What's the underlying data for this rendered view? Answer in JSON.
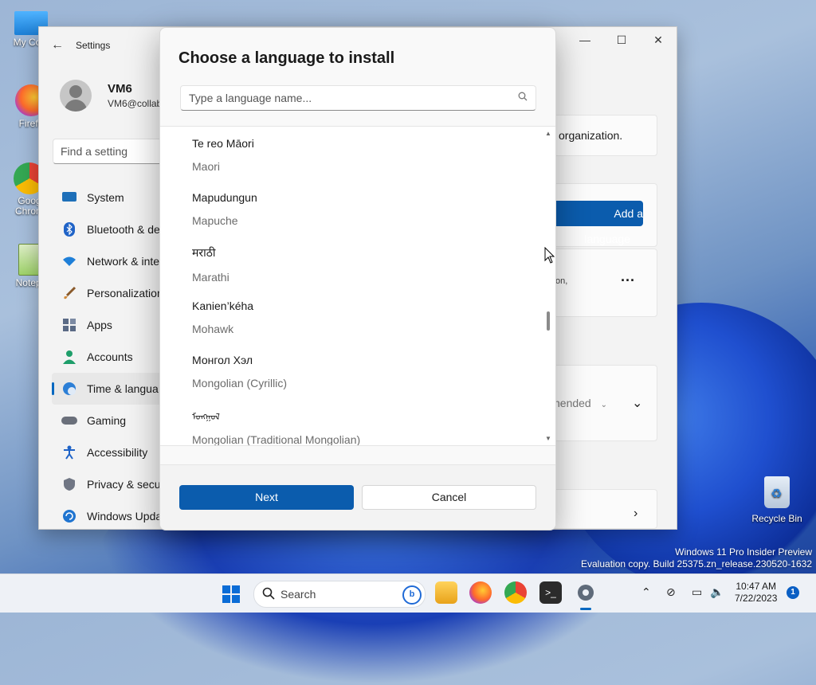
{
  "desktop": {
    "icons": [
      {
        "label": "My Com"
      },
      {
        "label": "Firefo"
      },
      {
        "label": "Goog Chrom"
      },
      {
        "label": "Notepa"
      }
    ],
    "recycle_bin": "Recycle Bin",
    "watermark": {
      "line1": "Windows 11 Pro Insider Preview",
      "line2": "Evaluation copy. Build 25375.zn_release.230520-1632"
    }
  },
  "settings": {
    "title": "Settings",
    "profile": {
      "name": "VM6",
      "email": "VM6@collab"
    },
    "find_placeholder": "Find a setting",
    "nav": [
      {
        "label": "System",
        "icon": "monitor-icon"
      },
      {
        "label": "Bluetooth & de",
        "icon": "bluetooth-icon"
      },
      {
        "label": "Network & inte",
        "icon": "wifi-icon"
      },
      {
        "label": "Personalization",
        "icon": "brush-icon"
      },
      {
        "label": "Apps",
        "icon": "apps-icon"
      },
      {
        "label": "Accounts",
        "icon": "person-icon"
      },
      {
        "label": "Time & langua",
        "icon": "globe-clock-icon",
        "active": true
      },
      {
        "label": "Gaming",
        "icon": "gamepad-icon"
      },
      {
        "label": "Accessibility",
        "icon": "accessibility-icon"
      },
      {
        "label": "Privacy & secu",
        "icon": "shield-icon"
      },
      {
        "label": "Windows Upda",
        "icon": "update-icon"
      }
    ],
    "content": {
      "org_text": "organization.",
      "add_language_label": "Add a language",
      "partial_text": "on,",
      "dropdown_text": "nended"
    }
  },
  "dialog": {
    "title": "Choose a language to install",
    "search_placeholder": "Type a language name...",
    "languages": [
      {
        "native": "Te reo Māori",
        "english": "Maori"
      },
      {
        "native": "Mapudungun",
        "english": "Mapuche"
      },
      {
        "native": "मराठी",
        "english": "Marathi"
      },
      {
        "native": "Kanien’kéha",
        "english": "Mohawk"
      },
      {
        "native": "Монгол Хэл",
        "english": "Mongolian (Cyrillic)"
      },
      {
        "native": "ᠮᠣᠩᠭᠣᠯ",
        "english": "Mongolian (Traditional Mongolian)"
      }
    ],
    "next_label": "Next",
    "cancel_label": "Cancel"
  },
  "taskbar": {
    "search_label": "Search",
    "clock": {
      "time": "10:47 AM",
      "date": "7/22/2023"
    },
    "notification_count": "1"
  }
}
